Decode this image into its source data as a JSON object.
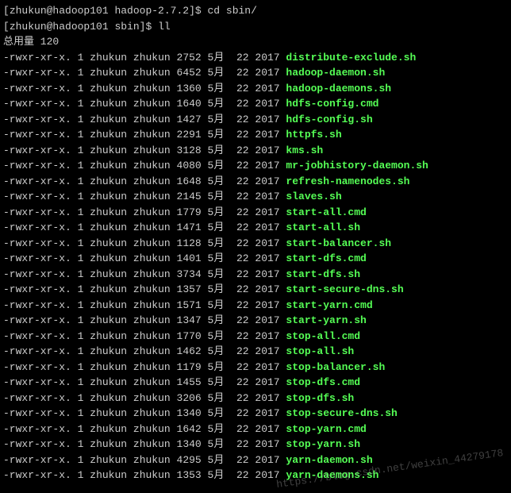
{
  "prompts": [
    {
      "user_host": "zhukun@hadoop101",
      "cwd": "hadoop-2.7.2",
      "cmd": "cd sbin/"
    },
    {
      "user_host": "zhukun@hadoop101",
      "cwd": "sbin",
      "cmd": "ll"
    }
  ],
  "total_label": "总用量 120",
  "files": [
    {
      "perms": "-rwxr-xr-x.",
      "links": "1",
      "owner": "zhukun",
      "group": "zhukun",
      "size": "2752",
      "month": "5月",
      "day": "22",
      "year": "2017",
      "name": "distribute-exclude.sh"
    },
    {
      "perms": "-rwxr-xr-x.",
      "links": "1",
      "owner": "zhukun",
      "group": "zhukun",
      "size": "6452",
      "month": "5月",
      "day": "22",
      "year": "2017",
      "name": "hadoop-daemon.sh"
    },
    {
      "perms": "-rwxr-xr-x.",
      "links": "1",
      "owner": "zhukun",
      "group": "zhukun",
      "size": "1360",
      "month": "5月",
      "day": "22",
      "year": "2017",
      "name": "hadoop-daemons.sh"
    },
    {
      "perms": "-rwxr-xr-x.",
      "links": "1",
      "owner": "zhukun",
      "group": "zhukun",
      "size": "1640",
      "month": "5月",
      "day": "22",
      "year": "2017",
      "name": "hdfs-config.cmd"
    },
    {
      "perms": "-rwxr-xr-x.",
      "links": "1",
      "owner": "zhukun",
      "group": "zhukun",
      "size": "1427",
      "month": "5月",
      "day": "22",
      "year": "2017",
      "name": "hdfs-config.sh"
    },
    {
      "perms": "-rwxr-xr-x.",
      "links": "1",
      "owner": "zhukun",
      "group": "zhukun",
      "size": "2291",
      "month": "5月",
      "day": "22",
      "year": "2017",
      "name": "httpfs.sh"
    },
    {
      "perms": "-rwxr-xr-x.",
      "links": "1",
      "owner": "zhukun",
      "group": "zhukun",
      "size": "3128",
      "month": "5月",
      "day": "22",
      "year": "2017",
      "name": "kms.sh"
    },
    {
      "perms": "-rwxr-xr-x.",
      "links": "1",
      "owner": "zhukun",
      "group": "zhukun",
      "size": "4080",
      "month": "5月",
      "day": "22",
      "year": "2017",
      "name": "mr-jobhistory-daemon.sh"
    },
    {
      "perms": "-rwxr-xr-x.",
      "links": "1",
      "owner": "zhukun",
      "group": "zhukun",
      "size": "1648",
      "month": "5月",
      "day": "22",
      "year": "2017",
      "name": "refresh-namenodes.sh"
    },
    {
      "perms": "-rwxr-xr-x.",
      "links": "1",
      "owner": "zhukun",
      "group": "zhukun",
      "size": "2145",
      "month": "5月",
      "day": "22",
      "year": "2017",
      "name": "slaves.sh"
    },
    {
      "perms": "-rwxr-xr-x.",
      "links": "1",
      "owner": "zhukun",
      "group": "zhukun",
      "size": "1779",
      "month": "5月",
      "day": "22",
      "year": "2017",
      "name": "start-all.cmd"
    },
    {
      "perms": "-rwxr-xr-x.",
      "links": "1",
      "owner": "zhukun",
      "group": "zhukun",
      "size": "1471",
      "month": "5月",
      "day": "22",
      "year": "2017",
      "name": "start-all.sh"
    },
    {
      "perms": "-rwxr-xr-x.",
      "links": "1",
      "owner": "zhukun",
      "group": "zhukun",
      "size": "1128",
      "month": "5月",
      "day": "22",
      "year": "2017",
      "name": "start-balancer.sh"
    },
    {
      "perms": "-rwxr-xr-x.",
      "links": "1",
      "owner": "zhukun",
      "group": "zhukun",
      "size": "1401",
      "month": "5月",
      "day": "22",
      "year": "2017",
      "name": "start-dfs.cmd"
    },
    {
      "perms": "-rwxr-xr-x.",
      "links": "1",
      "owner": "zhukun",
      "group": "zhukun",
      "size": "3734",
      "month": "5月",
      "day": "22",
      "year": "2017",
      "name": "start-dfs.sh"
    },
    {
      "perms": "-rwxr-xr-x.",
      "links": "1",
      "owner": "zhukun",
      "group": "zhukun",
      "size": "1357",
      "month": "5月",
      "day": "22",
      "year": "2017",
      "name": "start-secure-dns.sh"
    },
    {
      "perms": "-rwxr-xr-x.",
      "links": "1",
      "owner": "zhukun",
      "group": "zhukun",
      "size": "1571",
      "month": "5月",
      "day": "22",
      "year": "2017",
      "name": "start-yarn.cmd"
    },
    {
      "perms": "-rwxr-xr-x.",
      "links": "1",
      "owner": "zhukun",
      "group": "zhukun",
      "size": "1347",
      "month": "5月",
      "day": "22",
      "year": "2017",
      "name": "start-yarn.sh"
    },
    {
      "perms": "-rwxr-xr-x.",
      "links": "1",
      "owner": "zhukun",
      "group": "zhukun",
      "size": "1770",
      "month": "5月",
      "day": "22",
      "year": "2017",
      "name": "stop-all.cmd"
    },
    {
      "perms": "-rwxr-xr-x.",
      "links": "1",
      "owner": "zhukun",
      "group": "zhukun",
      "size": "1462",
      "month": "5月",
      "day": "22",
      "year": "2017",
      "name": "stop-all.sh"
    },
    {
      "perms": "-rwxr-xr-x.",
      "links": "1",
      "owner": "zhukun",
      "group": "zhukun",
      "size": "1179",
      "month": "5月",
      "day": "22",
      "year": "2017",
      "name": "stop-balancer.sh"
    },
    {
      "perms": "-rwxr-xr-x.",
      "links": "1",
      "owner": "zhukun",
      "group": "zhukun",
      "size": "1455",
      "month": "5月",
      "day": "22",
      "year": "2017",
      "name": "stop-dfs.cmd"
    },
    {
      "perms": "-rwxr-xr-x.",
      "links": "1",
      "owner": "zhukun",
      "group": "zhukun",
      "size": "3206",
      "month": "5月",
      "day": "22",
      "year": "2017",
      "name": "stop-dfs.sh"
    },
    {
      "perms": "-rwxr-xr-x.",
      "links": "1",
      "owner": "zhukun",
      "group": "zhukun",
      "size": "1340",
      "month": "5月",
      "day": "22",
      "year": "2017",
      "name": "stop-secure-dns.sh"
    },
    {
      "perms": "-rwxr-xr-x.",
      "links": "1",
      "owner": "zhukun",
      "group": "zhukun",
      "size": "1642",
      "month": "5月",
      "day": "22",
      "year": "2017",
      "name": "stop-yarn.cmd"
    },
    {
      "perms": "-rwxr-xr-x.",
      "links": "1",
      "owner": "zhukun",
      "group": "zhukun",
      "size": "1340",
      "month": "5月",
      "day": "22",
      "year": "2017",
      "name": "stop-yarn.sh"
    },
    {
      "perms": "-rwxr-xr-x.",
      "links": "1",
      "owner": "zhukun",
      "group": "zhukun",
      "size": "4295",
      "month": "5月",
      "day": "22",
      "year": "2017",
      "name": "yarn-daemon.sh"
    },
    {
      "perms": "-rwxr-xr-x.",
      "links": "1",
      "owner": "zhukun",
      "group": "zhukun",
      "size": "1353",
      "month": "5月",
      "day": "22",
      "year": "2017",
      "name": "yarn-daemons.sh"
    }
  ],
  "watermark": "https://blog.csdn.net/weixin_44279178"
}
